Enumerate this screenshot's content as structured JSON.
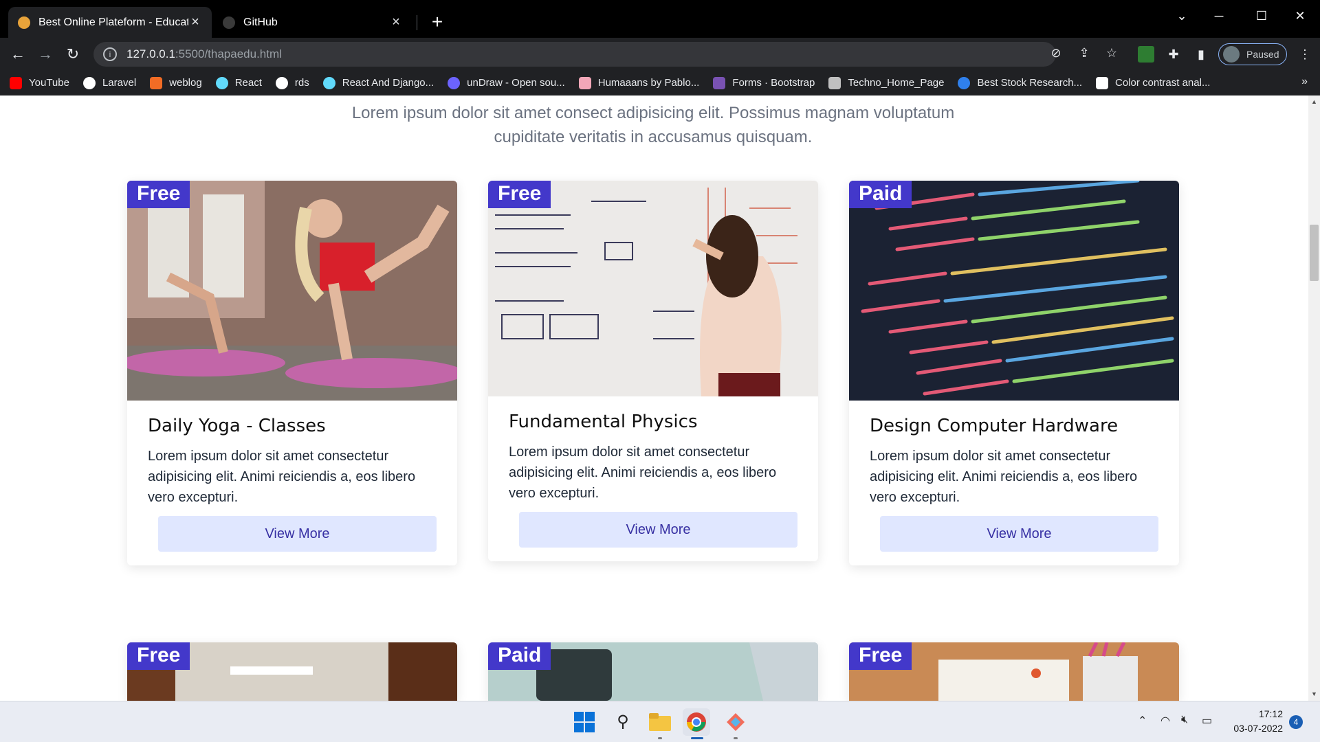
{
  "browser": {
    "tabs": [
      {
        "title": "Best Online Plateform - Educatio",
        "active": true
      },
      {
        "title": "GitHub",
        "active": false
      }
    ],
    "url_host": "127.0.0.1",
    "url_path": ":5500/thapaedu.html",
    "profile_label": "Paused",
    "bookmarks": [
      {
        "label": "YouTube",
        "color": "#ff0000"
      },
      {
        "label": "Laravel",
        "color": "#ffffff"
      },
      {
        "label": "weblog",
        "color": "#f26c25"
      },
      {
        "label": "React",
        "color": "#61dafb"
      },
      {
        "label": "rds",
        "color": "#ffffff"
      },
      {
        "label": "React And Django...",
        "color": "#61dafb"
      },
      {
        "label": "unDraw - Open sou...",
        "color": "#6c63ff"
      },
      {
        "label": "Humaaans by Pablo...",
        "color": "#f2a7b8"
      },
      {
        "label": "Forms · Bootstrap",
        "color": "#7952b3"
      },
      {
        "label": "Techno_Home_Page",
        "color": "#c0c0c0"
      },
      {
        "label": "Best Stock Research...",
        "color": "#2f80ed"
      },
      {
        "label": "Color contrast anal...",
        "color": "#ffffff"
      }
    ]
  },
  "page": {
    "intro": "Lorem ipsum dolor sit amet consect adipisicing elit. Possimus magnam voluptatum cupiditate veritatis in accusamus quisquam.",
    "cards": [
      {
        "badge": "Free",
        "title": "Daily Yoga - Classes",
        "desc": "Lorem ipsum dolor sit amet consectetur adipisicing elit. Animi reiciendis a, eos libero vero excepturi.",
        "button": "View More"
      },
      {
        "badge": "Free",
        "title": "Fundamental Physics",
        "desc": "Lorem ipsum dolor sit amet consectetur adipisicing elit. Animi reiciendis a, eos libero vero excepturi.",
        "button": "View More"
      },
      {
        "badge": "Paid",
        "title": "Design Computer Hardware",
        "desc": "Lorem ipsum dolor sit amet consectetur adipisicing elit. Animi reiciendis a, eos libero vero excepturi.",
        "button": "View More"
      }
    ],
    "next_row_badges": [
      "Free",
      "Paid",
      "Free"
    ],
    "accent_color": "#4338ca",
    "button_bg": "#e0e7ff"
  },
  "taskbar": {
    "time": "17:12",
    "date": "03-07-2022",
    "notification_count": "4"
  }
}
